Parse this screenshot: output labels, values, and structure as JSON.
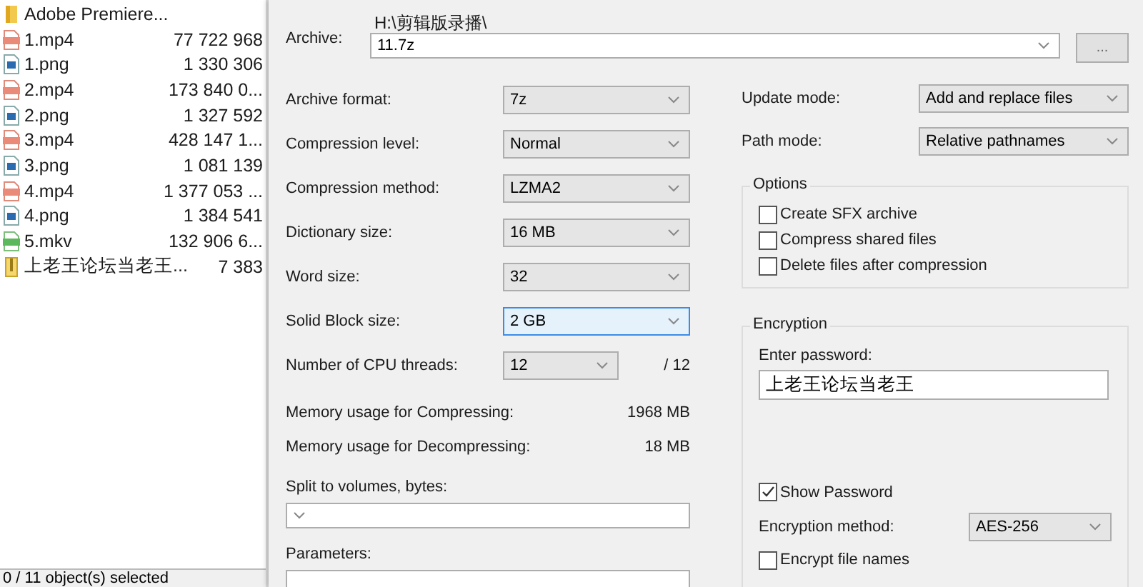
{
  "file_list": [
    {
      "name": "Adobe Premiere...",
      "kind": "folder"
    },
    {
      "name": "1.mp4",
      "size": "77 722 968",
      "kind": "video"
    },
    {
      "name": "1.png",
      "size": "1 330 306",
      "kind": "image"
    },
    {
      "name": "2.mp4",
      "size": "173 840 0...",
      "kind": "video"
    },
    {
      "name": "2.png",
      "size": "1 327 592",
      "kind": "image"
    },
    {
      "name": "3.mp4",
      "size": "428 147 1...",
      "kind": "video"
    },
    {
      "name": "3.png",
      "size": "1 081 139",
      "kind": "image"
    },
    {
      "name": "4.mp4",
      "size": "1 377 053 ...",
      "kind": "video"
    },
    {
      "name": "4.png",
      "size": "1 384 541",
      "kind": "image"
    },
    {
      "name": "5.mkv",
      "size": "132 906 6...",
      "kind": "mkv"
    },
    {
      "name": "上老王论坛当老王...",
      "size": "7 383",
      "kind": "archive"
    }
  ],
  "status_bar": "0 / 11 object(s) selected",
  "archive": {
    "label": "Archive:",
    "path": "H:\\剪辑版录播\\",
    "value": "11.7z",
    "browse_button": "..."
  },
  "settings": [
    {
      "kind": "combo",
      "label": "Archive format:",
      "value": "7z",
      "focused": false
    },
    {
      "kind": "combo",
      "label": "Compression level:",
      "value": "Normal",
      "focused": false
    },
    {
      "kind": "combo",
      "label": "Compression method:",
      "value": "LZMA2",
      "focused": false
    },
    {
      "kind": "combo",
      "label": "Dictionary size:",
      "value": "16 MB",
      "focused": false
    },
    {
      "kind": "combo",
      "label": "Word size:",
      "value": "32",
      "focused": false
    },
    {
      "kind": "combo",
      "label": "Solid Block size:",
      "value": "2 GB",
      "focused": true
    },
    {
      "kind": "threads",
      "label": "Number of CPU threads:",
      "value": "12",
      "max": "/ 12",
      "focused": false
    },
    {
      "kind": "info",
      "label": "Memory usage for Compressing:",
      "value": "1968 MB"
    },
    {
      "kind": "info",
      "label": "Memory usage for Decompressing:",
      "value": "18 MB"
    }
  ],
  "split": {
    "label": "Split to volumes, bytes:"
  },
  "parameters": {
    "label": "Parameters:"
  },
  "modes": [
    {
      "label": "Update mode:",
      "value": "Add and replace files"
    },
    {
      "label": "Path mode:",
      "value": "Relative pathnames"
    }
  ],
  "options": {
    "title": "Options",
    "items": [
      {
        "label": "Create SFX archive",
        "checked": false
      },
      {
        "label": "Compress shared files",
        "checked": false
      },
      {
        "label": "Delete files after compression",
        "checked": false
      }
    ]
  },
  "encryption": {
    "title": "Encryption",
    "password_label": "Enter password:",
    "password": "上老王论坛当老王",
    "show_password": {
      "label": "Show Password",
      "checked": true
    },
    "method": {
      "label": "Encryption method:",
      "value": "AES-256"
    },
    "encrypt_names": {
      "label": "Encrypt file names",
      "checked": false
    }
  }
}
